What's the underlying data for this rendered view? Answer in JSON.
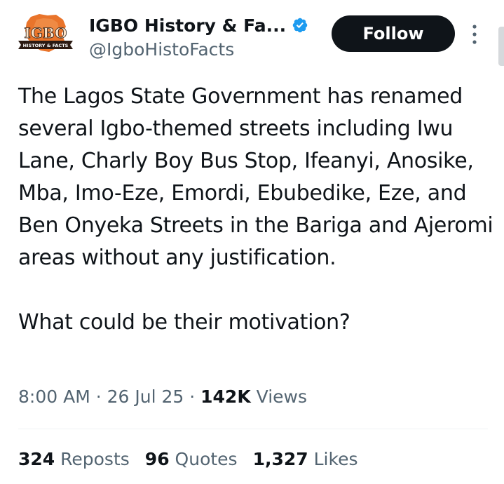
{
  "author": {
    "avatar_text": "IGBO",
    "avatar_subtext": "HISTORY & FACTS",
    "display_name": "IGBO History & Fa...",
    "handle": "@IgboHistoFacts",
    "verified": true,
    "verified_color": "#1d9bf0"
  },
  "actions": {
    "follow_label": "Follow",
    "more_icon": "more-vertical-icon"
  },
  "tweet": {
    "paragraphs": [
      "The Lagos State Government has renamed several Igbo-themed streets including Iwu Lane, Charly Boy Bus Stop, Ifeanyi, Anosike, Mba, Imo-Eze, Emordi, Ebubedike, Eze, and Ben Onyeka Streets in the Bariga and Ajeromi areas without any justification.",
      "What could be their motivation?"
    ]
  },
  "meta": {
    "time": "8:00 AM",
    "sep1": " · ",
    "date": "26 Jul 25",
    "sep2": " · ",
    "views_count": "142K",
    "views_label": " Views"
  },
  "stats": {
    "reposts_count": "324",
    "reposts_label": "Reposts",
    "quotes_count": "96",
    "quotes_label": "Quotes",
    "likes_count": "1,327",
    "likes_label": "Likes"
  },
  "colors": {
    "text_primary": "#0f1419",
    "text_secondary": "#536471",
    "follow_bg": "#0f1419",
    "avatar_orange": "#e9742b",
    "avatar_dark": "#2b1a12"
  }
}
